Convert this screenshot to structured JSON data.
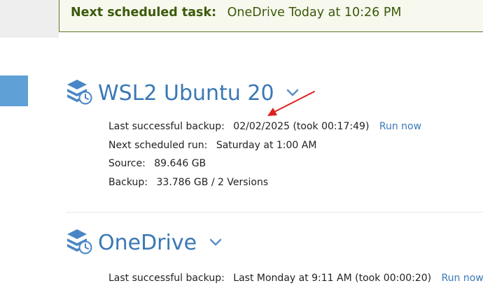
{
  "banner": {
    "label": "Next scheduled task:",
    "value": "OneDrive Today at 10:26 PM"
  },
  "jobs": [
    {
      "title": "WSL2 Ubuntu 20",
      "last_backup_label": "Last successful backup:",
      "last_backup_value": "02/02/2025 (took 00:17:49)",
      "run_now": "Run now",
      "next_run_label": "Next scheduled run:",
      "next_run_value": "Saturday at 1:00 AM",
      "source_label": "Source:",
      "source_value": "89.646 GB",
      "backup_label": "Backup:",
      "backup_value": "33.786 GB / 2 Versions"
    },
    {
      "title": "OneDrive",
      "last_backup_label": "Last successful backup:",
      "last_backup_value": "Last Monday at 9:11 AM (took 00:00:20)",
      "run_now": "Run now"
    }
  ],
  "colors": {
    "accent": "#3a78b5",
    "banner_text": "#3b5a0a",
    "banner_border": "#5d7a2b",
    "annotation_arrow": "#e02020"
  },
  "icons": {
    "job_icon": "database-clock-icon",
    "expand_icon": "chevron-down-icon",
    "annotation": "red-arrow-annotation"
  }
}
